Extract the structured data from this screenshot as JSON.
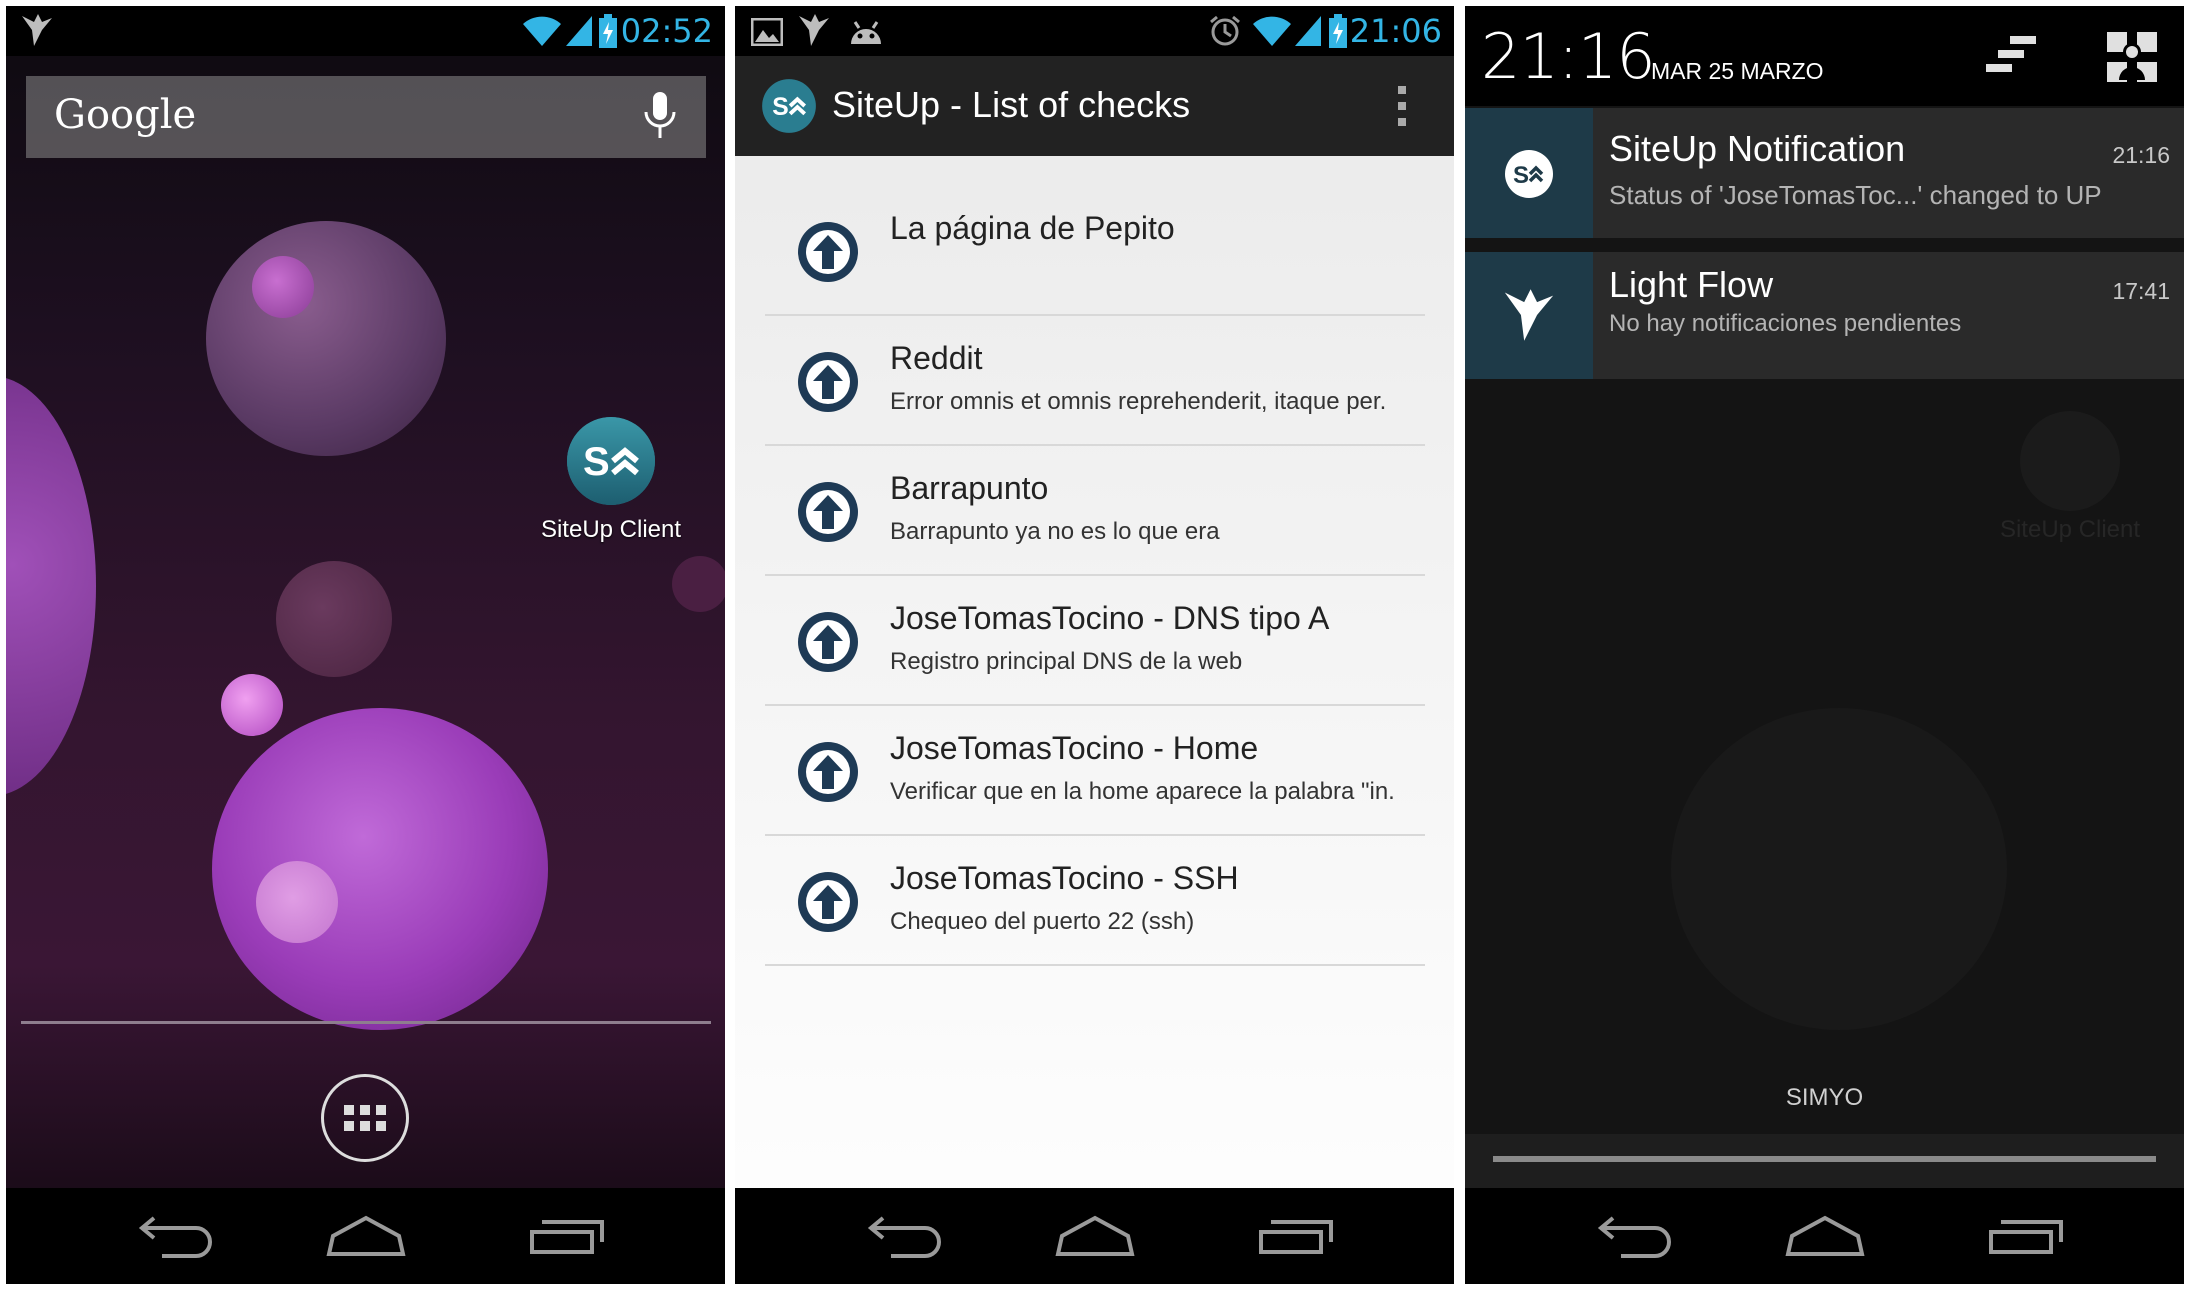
{
  "home": {
    "status_time": "02:52",
    "search_logo": "Google",
    "app_label": "SiteUp Client"
  },
  "checks_screen": {
    "status_time": "21:06",
    "title": "SiteUp - List of checks",
    "items": [
      {
        "title": "La página de Pepito",
        "desc": ""
      },
      {
        "title": "Reddit",
        "desc": "Error omnis et omnis reprehenderit, itaque per."
      },
      {
        "title": "Barrapunto",
        "desc": "Barrapunto ya no es lo que era"
      },
      {
        "title": "JoseTomasTocino - DNS tipo A",
        "desc": "Registro principal DNS de la web"
      },
      {
        "title": "JoseTomasTocino - Home",
        "desc": "Verificar que en la home aparece la palabra \"in."
      },
      {
        "title": "JoseTomasTocino - SSH",
        "desc": "Chequeo del puerto 22 (ssh)"
      }
    ]
  },
  "notifications": {
    "time": "21:16",
    "date": "MAR 25 MARZO",
    "items": [
      {
        "title": "SiteUp Notification",
        "time": "21:16",
        "text": "Status of 'JoseTomasToc...' changed to UP"
      },
      {
        "title": "Light Flow",
        "time": "17:41",
        "text": "No hay notificaciones pendientes"
      }
    ],
    "carrier": "SIMYO",
    "ghost_label": "SiteUp Client"
  },
  "colors": {
    "holo_blue": "#33b5e5",
    "action_bar": "#222222",
    "check_up_icon": "#1e3a55",
    "notif_icon_bg": "#1e3a48"
  },
  "icons": [
    "lightflow-icon",
    "wifi-icon",
    "signal-icon",
    "battery-icon",
    "mic-icon",
    "siteup-logo-icon",
    "apps-grid-icon",
    "image-icon",
    "android-icon",
    "alarm-icon",
    "overflow-menu-icon",
    "arrow-up-circle-icon",
    "clear-all-icon",
    "quick-settings-icon",
    "back-icon",
    "home-icon",
    "recents-icon"
  ]
}
